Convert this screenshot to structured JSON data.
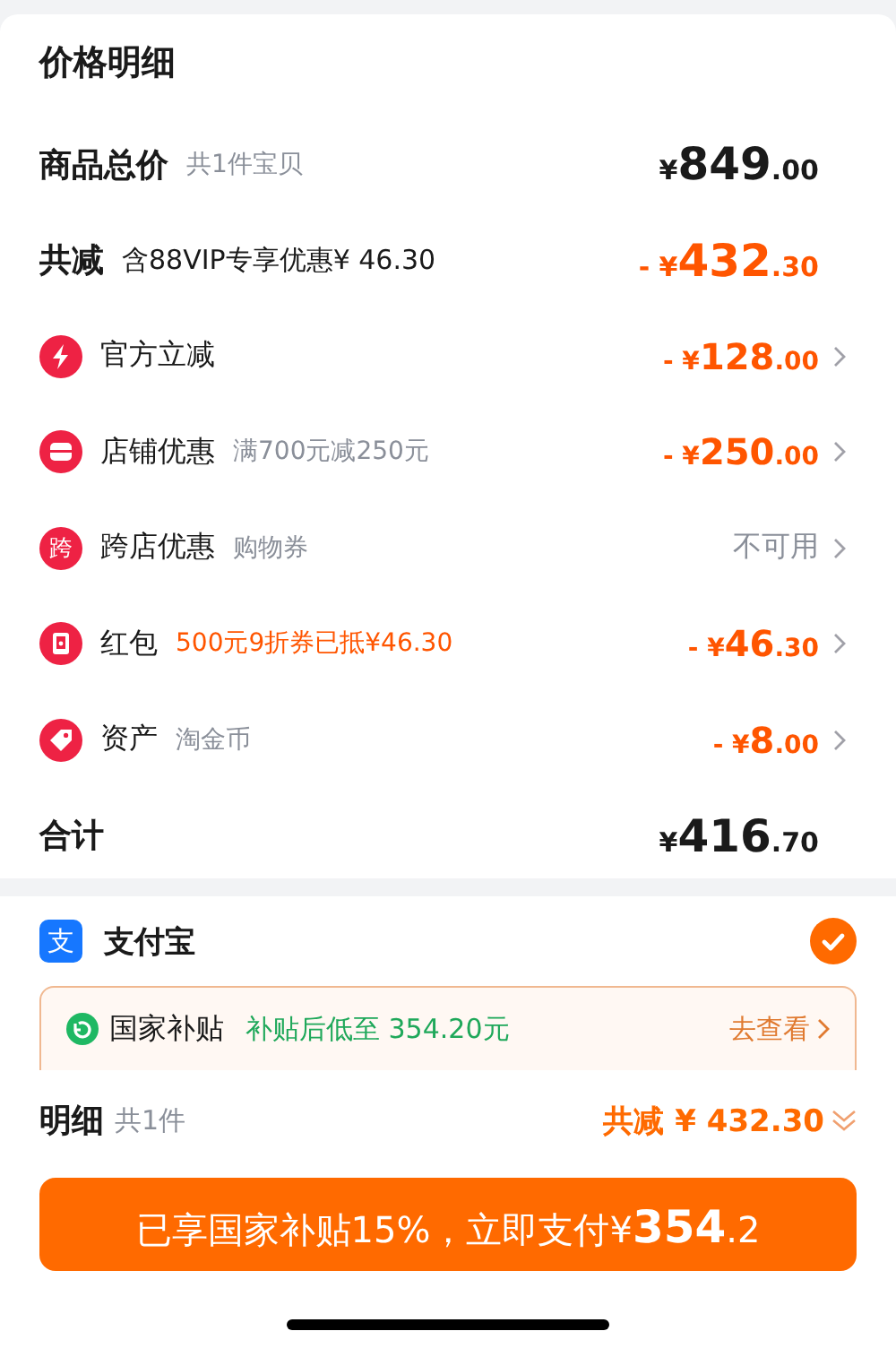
{
  "title": "价格明细",
  "rows": [
    {
      "kind": "subtotal",
      "label": "商品总价",
      "note": "共1件宝贝",
      "amount": {
        "prefix": "¥",
        "whole": "849",
        "fraction": ".00"
      }
    },
    {
      "kind": "reduction",
      "label": "共减",
      "note": "含88VIP专享优惠¥ 46.30",
      "amount": {
        "prefix": "- ¥",
        "whole": "432",
        "fraction": ".30"
      }
    },
    {
      "kind": "item",
      "label": "官方立减",
      "amount": {
        "prefix": "- ¥",
        "whole": "128",
        "fraction": ".00"
      }
    },
    {
      "kind": "item",
      "label": "店铺优惠",
      "note": "满700元减250元",
      "amount": {
        "prefix": "- ¥",
        "whole": "250",
        "fraction": ".00"
      }
    },
    {
      "kind": "item",
      "icon_text": "跨",
      "label": "跨店优惠",
      "note": "购物券",
      "value": "不可用"
    },
    {
      "kind": "voucher",
      "label": "红包",
      "note": "500元9折券已抵¥46.30",
      "amount": {
        "prefix": "- ¥",
        "whole": "46",
        "fraction": ".30"
      }
    },
    {
      "kind": "item",
      "label": "资产",
      "note": "淘金币",
      "amount": {
        "prefix": "- ¥",
        "whole": "8",
        "fraction": ".00"
      }
    },
    {
      "kind": "subtotal",
      "label": "合计",
      "amount": {
        "prefix": "¥",
        "whole": "416",
        "fraction": ".70"
      }
    }
  ],
  "payment": {
    "name": "支付宝",
    "icon_text": "支",
    "selected": true
  },
  "subsidy": {
    "label": "国家补贴",
    "note": "补贴后低至 354.20元",
    "link": "去查看"
  },
  "summary": {
    "label": "明细",
    "count": "共1件",
    "reduction": "共减 ¥ 432.30"
  },
  "pay_button": {
    "label": "已享国家补贴15%，立即支付¥",
    "whole": "354",
    "fraction": ".2"
  }
}
